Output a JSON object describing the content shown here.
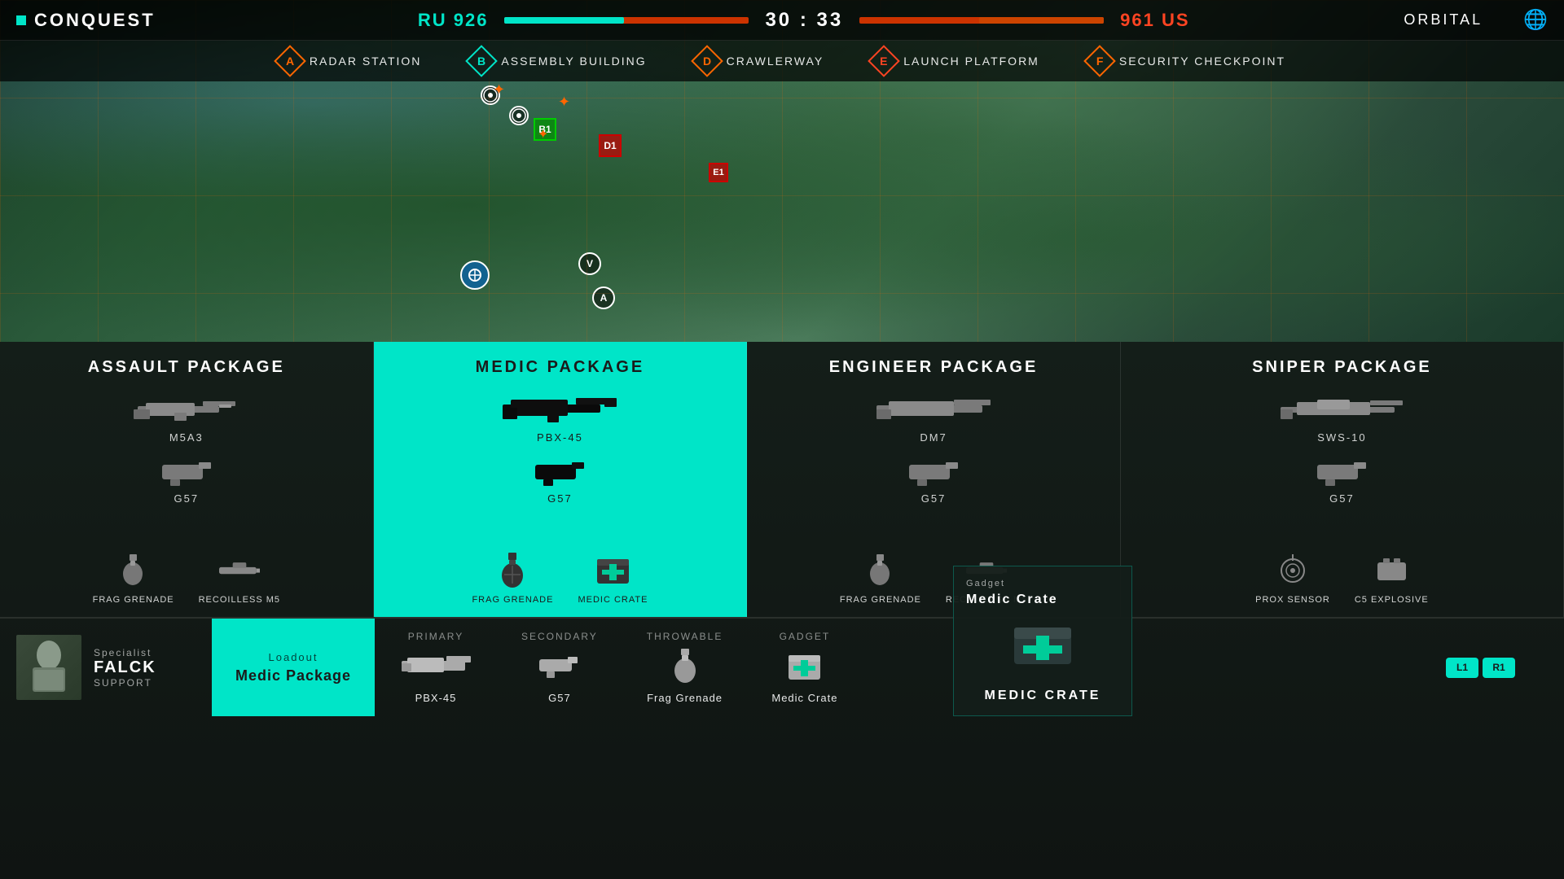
{
  "topbar": {
    "mode": "CONQUEST",
    "dot_color": "#00e5c8",
    "ru_score": "RU 926",
    "timer": "30 : 33",
    "us_score": "961 US",
    "map_name": "ORBITAL"
  },
  "objectives": [
    {
      "id": "A",
      "label": "RADAR STATION"
    },
    {
      "id": "B",
      "label": "ASSEMBLY BUILDING"
    },
    {
      "id": "D",
      "label": "CRAWLERWAY"
    },
    {
      "id": "E",
      "label": "LAUNCH PLATFORM"
    },
    {
      "id": "F",
      "label": "SECURITY CHECKPOINT"
    }
  ],
  "packages": [
    {
      "id": "assault",
      "title": "ASSAULT PACKAGE",
      "primary": {
        "name": "M5A3"
      },
      "secondary": {
        "name": "G57"
      },
      "gadget1": {
        "name": "FRAG GRENADE"
      },
      "gadget2": {
        "name": "RECOILLESS M5"
      },
      "active": false
    },
    {
      "id": "medic",
      "title": "MEDIC PACKAGE",
      "primary": {
        "name": "PBX-45"
      },
      "secondary": {
        "name": "G57"
      },
      "gadget1": {
        "name": "FRAG GRENADE"
      },
      "gadget2": {
        "name": "MEDIC CRATE"
      },
      "active": true
    },
    {
      "id": "engineer",
      "title": "ENGINEER PACKAGE",
      "primary": {
        "name": "DM7"
      },
      "secondary": {
        "name": "G57"
      },
      "gadget1": {
        "name": "FRAG GRENADE"
      },
      "gadget2": {
        "name": "RECOILLESS M5"
      },
      "active": false
    },
    {
      "id": "sniper",
      "title": "SNIPER PACKAGE",
      "primary": {
        "name": "SWS-10"
      },
      "secondary": {
        "name": "G57"
      },
      "gadget1": {
        "name": "PROX SENSOR"
      },
      "gadget2": {
        "name": "C5 EXPLOSIVE"
      },
      "active": false
    }
  ],
  "loadout": {
    "specialist_label": "Specialist",
    "specialist_name": "FALCK",
    "specialist_class": "SUPPORT",
    "loadout_label": "Loadout",
    "loadout_value": "Medic Package",
    "primary_label": "Primary",
    "primary_name": "PBX-45",
    "secondary_label": "SECONDARY",
    "secondary_name": "G57",
    "throwable_label": "Throwable",
    "throwable_name": "Frag Grenade",
    "gadget_label": "Gadget",
    "gadget_name": "Medic Crate",
    "lb_label": "L1",
    "rb_label": "R1"
  },
  "tooltip": {
    "category": "Gadget",
    "name": "Medic Crate",
    "subtitle": "MEDIC CRATE"
  }
}
